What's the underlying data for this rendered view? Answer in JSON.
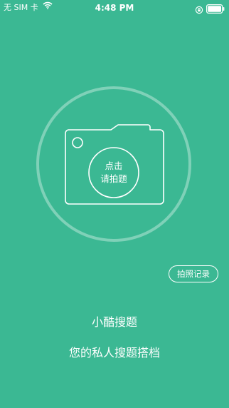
{
  "status_bar": {
    "carrier": "无 SIM 卡",
    "time": "4:48 PM",
    "battery_level": 1.0
  },
  "camera": {
    "line1": "点击",
    "line2": "请拍题"
  },
  "history_button": {
    "label": "拍照记录"
  },
  "footer": {
    "app_name": "小酷搜题",
    "slogan": "您的私人搜题搭档"
  },
  "colors": {
    "background": "#3bb893",
    "foreground": "#ffffff"
  },
  "icons": {
    "wifi": "wifi-icon",
    "orientation_lock": "orientation-lock-icon",
    "battery": "battery-icon",
    "camera": "camera-icon"
  }
}
